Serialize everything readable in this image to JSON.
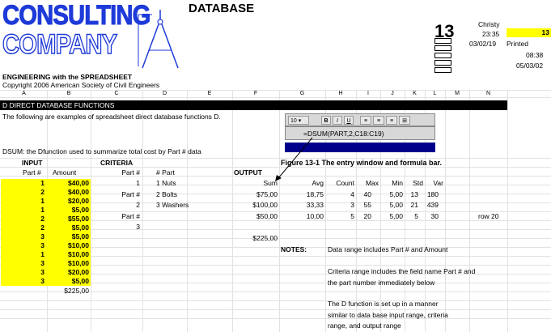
{
  "logo": {
    "line1": "CONSULTING",
    "line2": "COMPANY"
  },
  "header": {
    "title": "DATABASE",
    "chapter": "13",
    "author": "Christy",
    "time": "23:35",
    "date": "03/02/19",
    "printed_label": "Printed",
    "highlight_value": "13",
    "print_time": "08:38",
    "print_date": "05/03/02"
  },
  "book": {
    "subtitle": "ENGINEERING with the SPREADSHEET",
    "copyright": "Copyright 2006 American Society of Civil Engineers"
  },
  "columns": [
    "A",
    "B",
    "C",
    "D",
    "E",
    "F",
    "G",
    "H",
    "I",
    "J",
    "K",
    "L",
    "M",
    "N"
  ],
  "section": {
    "title": "D DIRECT DATABASE FUNCTIONS",
    "intro": "The following are examples of spreadsheet direct database functions  D.",
    "dsum_note": "DSUM: the Dfunction used to summarize total cost by Part # data"
  },
  "toolbar": {
    "font_size": "10",
    "bold": "B",
    "italic": "I",
    "underline": "U",
    "formula_prefix": "=",
    "formula": "=DSUM(PART,2,C18:C19)"
  },
  "figure_caption": "Figure 13-1  The entry window and formula bar.",
  "input": {
    "title": "INPUT",
    "col_part": "Part #",
    "col_amount": "Amount",
    "rows": [
      {
        "part": "1",
        "amount": "$40,00"
      },
      {
        "part": "2",
        "amount": "$40,00"
      },
      {
        "part": "1",
        "amount": "$20,00"
      },
      {
        "part": "1",
        "amount": "$5,00"
      },
      {
        "part": "2",
        "amount": "$55,00"
      },
      {
        "part": "2",
        "amount": "$5,00"
      },
      {
        "part": "3",
        "amount": "$5,00"
      },
      {
        "part": "3",
        "amount": "$10,00"
      },
      {
        "part": "1",
        "amount": "$10,00"
      },
      {
        "part": "3",
        "amount": "$10,00"
      },
      {
        "part": "3",
        "amount": "$20,00"
      },
      {
        "part": "3",
        "amount": "$5,00"
      }
    ],
    "total": "$225,00"
  },
  "criteria": {
    "title": "CRITERIA",
    "cells": [
      "Part #",
      "1",
      "Part #",
      "2",
      "Part #",
      "3"
    ]
  },
  "parts": {
    "col_num": "# Part",
    "rows": [
      "1 Nuts",
      "2 Bolts",
      "3 Washers"
    ]
  },
  "output": {
    "title": "OUTPUT",
    "headers": {
      "sum": "Sum",
      "avg": "Avg",
      "count": "Count",
      "max": "Max",
      "min": "Min",
      "std": "Std",
      "var": "Var"
    },
    "rows": [
      {
        "sum": "$75,00",
        "avg": "18,75",
        "count": "4",
        "max": "40",
        "min": "5,00",
        "std": "13",
        "var": "180"
      },
      {
        "sum": "$100,00",
        "avg": "33,33",
        "count": "3",
        "max": "55",
        "min": "5,00",
        "std": "21",
        "var": "439"
      },
      {
        "sum": "$50,00",
        "avg": "10,00",
        "count": "5",
        "max": "20",
        "min": "5,00",
        "std": "5",
        "var": "30"
      }
    ],
    "total": "$225,00",
    "row_note": "row 20"
  },
  "notes": {
    "label": "NOTES:",
    "items": [
      "Data range includes Part # and Amount",
      "Criteria range includes the field name Part # and",
      "the part number immediately below",
      "The D function is set up in a manner",
      "similar to data base input range, criteria",
      "range, and output range"
    ]
  },
  "colors": {
    "accent": "#1e3ad8",
    "highlight": "#ffff00",
    "section_bar": "#000000",
    "title_bar": "#00008b"
  }
}
